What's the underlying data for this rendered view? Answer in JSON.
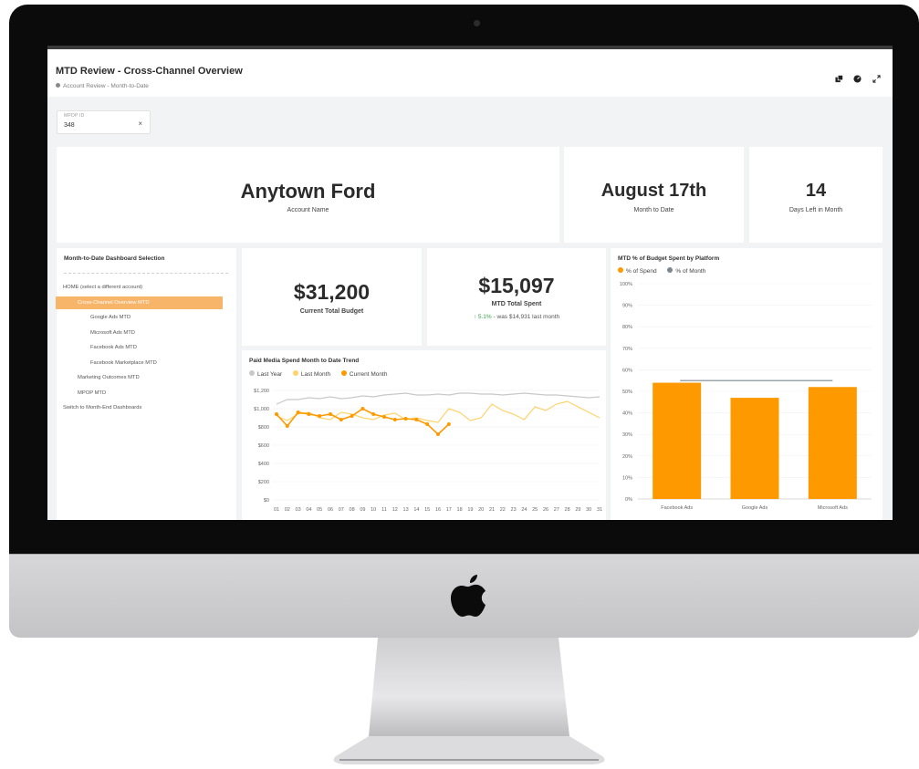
{
  "dashboard": {
    "title": "MTD Review - Cross-Channel Overview",
    "breadcrumb": "Account Review - Month-to-Date",
    "toolbar_icons": [
      "copy-icon",
      "gauge-icon",
      "expand-icon"
    ]
  },
  "filter": {
    "label": "MPOP ID",
    "value": "348",
    "clear": "×"
  },
  "kpis": {
    "account_name": {
      "value": "Anytown Ford",
      "label": "Account Name"
    },
    "month_to_date": {
      "value": "August 17th",
      "label": "Month to Date"
    },
    "days_left": {
      "value": "14",
      "label": "Days Left in Month"
    },
    "total_budget": {
      "value": "$31,200",
      "label": "Current Total Budget"
    },
    "total_spent": {
      "value": "$15,097",
      "label": "MTD Total Spent",
      "delta": "5.1%",
      "delta_text": "- was $14,931 last month"
    }
  },
  "nav": {
    "title": "Month-to-Date Dashboard Selection",
    "items": [
      {
        "label": "HOME (select a different account)",
        "level": 0,
        "active": false
      },
      {
        "label": "Cross-Channel Overview MTD",
        "level": 1,
        "active": true
      },
      {
        "label": "Google Ads MTD",
        "level": 2,
        "active": false
      },
      {
        "label": "Microsoft Ads MTD",
        "level": 2,
        "active": false
      },
      {
        "label": "Facebook Ads MTD",
        "level": 2,
        "active": false
      },
      {
        "label": "Facebook Marketplace MTD",
        "level": 2,
        "active": false
      },
      {
        "label": "Marketing Outcomes MTD",
        "level": 1,
        "active": false
      },
      {
        "label": "MPOP MTD",
        "level": 1,
        "active": false
      },
      {
        "label": "Switch to Month-End Dashboards",
        "level": 0,
        "active": false
      }
    ]
  },
  "colors": {
    "orange": "#ff9900",
    "yellow": "#ffd36a",
    "gray": "#c8c8c8",
    "bar": "#ff9900",
    "month_line": "#7c8890"
  },
  "chart_data": [
    {
      "type": "line",
      "title": "Paid Media Spend Month to Date Trend",
      "x": [
        "01",
        "02",
        "03",
        "04",
        "05",
        "06",
        "07",
        "08",
        "09",
        "10",
        "11",
        "12",
        "13",
        "14",
        "15",
        "16",
        "17",
        "18",
        "19",
        "20",
        "21",
        "22",
        "23",
        "24",
        "25",
        "26",
        "27",
        "28",
        "29",
        "30",
        "31"
      ],
      "ylim": [
        0,
        1200
      ],
      "y_ticks": [
        "$0",
        "$200",
        "$400",
        "$600",
        "$800",
        "$1,000",
        "$1,200"
      ],
      "series": [
        {
          "name": "Last Year",
          "color": "#c8c8c8",
          "values": [
            1050,
            1100,
            1100,
            1120,
            1110,
            1130,
            1110,
            1120,
            1140,
            1130,
            1150,
            1160,
            1170,
            1150,
            1150,
            1160,
            1150,
            1170,
            1170,
            1160,
            1160,
            1150,
            1160,
            1170,
            1160,
            1150,
            1150,
            1140,
            1130,
            1120,
            1130
          ]
        },
        {
          "name": "Last Month",
          "color": "#ffd36a",
          "values": [
            920,
            870,
            940,
            960,
            900,
            880,
            960,
            940,
            900,
            880,
            930,
            950,
            880,
            900,
            870,
            850,
            1000,
            960,
            870,
            900,
            1050,
            980,
            940,
            880,
            1020,
            980,
            1050,
            1080,
            1020,
            960,
            900
          ]
        },
        {
          "name": "Current Month",
          "color": "#ff9900",
          "values": [
            940,
            810,
            960,
            940,
            920,
            940,
            880,
            920,
            1000,
            940,
            910,
            880,
            890,
            880,
            830,
            720,
            830
          ]
        }
      ]
    },
    {
      "type": "bar",
      "title": "MTD % of Budget Spent by Platform",
      "categories": [
        "Facebook Ads",
        "Google Ads",
        "Microsoft Ads"
      ],
      "ylim": [
        0,
        100
      ],
      "y_ticks": [
        "0%",
        "10%",
        "20%",
        "30%",
        "40%",
        "50%",
        "60%",
        "70%",
        "80%",
        "90%",
        "100%"
      ],
      "series": [
        {
          "name": "% of Spend",
          "color": "#ff9900",
          "values": [
            54,
            47,
            52
          ]
        },
        {
          "name": "% of Month",
          "color": "#7c8890",
          "values": [
            55,
            55,
            55
          ]
        }
      ]
    }
  ]
}
